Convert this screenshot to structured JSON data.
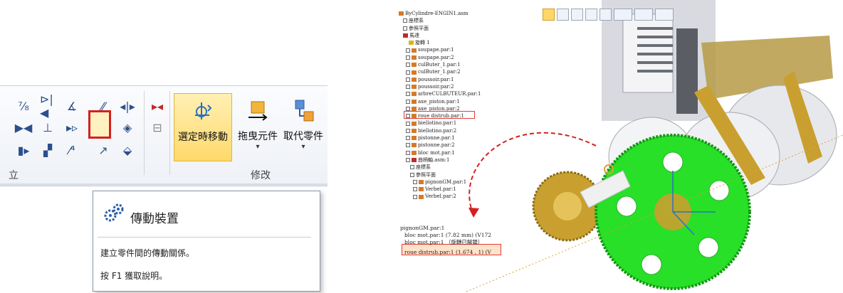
{
  "ribbon": {
    "left_group_label": "立",
    "modify_group_label": "修改",
    "small_tools_row1": [
      "⁷⁄₈",
      "⊳|◀",
      "∡",
      "⁄⁄",
      "◂|▸",
      "▸◂"
    ],
    "small_tools_row2": [
      "▶◀",
      "⊥",
      "▸▹",
      "⚙",
      "◈",
      "⊟"
    ],
    "small_tools_row3": [
      "▮▸",
      "▗▘",
      "⁄⁴",
      "↗",
      "⬙"
    ],
    "move_on_select_label": "選定時移動",
    "drag_component_label": "拖曳元件",
    "replace_part_label": "取代零件",
    "dropdown_marker": "▾"
  },
  "tooltip": {
    "title": "傳動裝置",
    "description": "建立零件間的傳動關係。",
    "help": "按 F1 獲取說明。"
  },
  "tree": {
    "root": "ByCylindre-ENGIN1.asm",
    "items": [
      "座標系",
      "參照平面",
      "馬達",
      "旋轉 1",
      "soupape.par:1",
      "soupape.par:2",
      "culButer_1.par:1",
      "culButer_1.par:2",
      "poussoir.par:1",
      "poussoir.par:2",
      "arbreCULBUTEUR.par:1",
      "axe_piston.par:1",
      "axe_piston.par:2",
      "roue distrub.par:1",
      "biellotino.par:1",
      "biellotino.par:2",
      "pistonne.par:1",
      "pistonne.par:2",
      "bloc mot.par:1",
      "曲柄軸.asm:1",
      "座標系",
      "參照平面",
      "pignonGM.par:1",
      "Verbel.par:1",
      "Verbel.par:2"
    ]
  },
  "relations": {
    "header": "pignonGM.par:1",
    "rows": [
      "bloc mot.par:1  (7.82 mm)  (V172",
      "bloc mot.par:1  （旋轉已解鎖）",
      "roue distrub.par:1  (1.674 , 1)  (V"
    ]
  },
  "colors": {
    "highlight_red": "#d42020",
    "selected_yellow": "#ffd96b",
    "gear_green": "#27e027",
    "gear_gold": "#c9a030"
  }
}
